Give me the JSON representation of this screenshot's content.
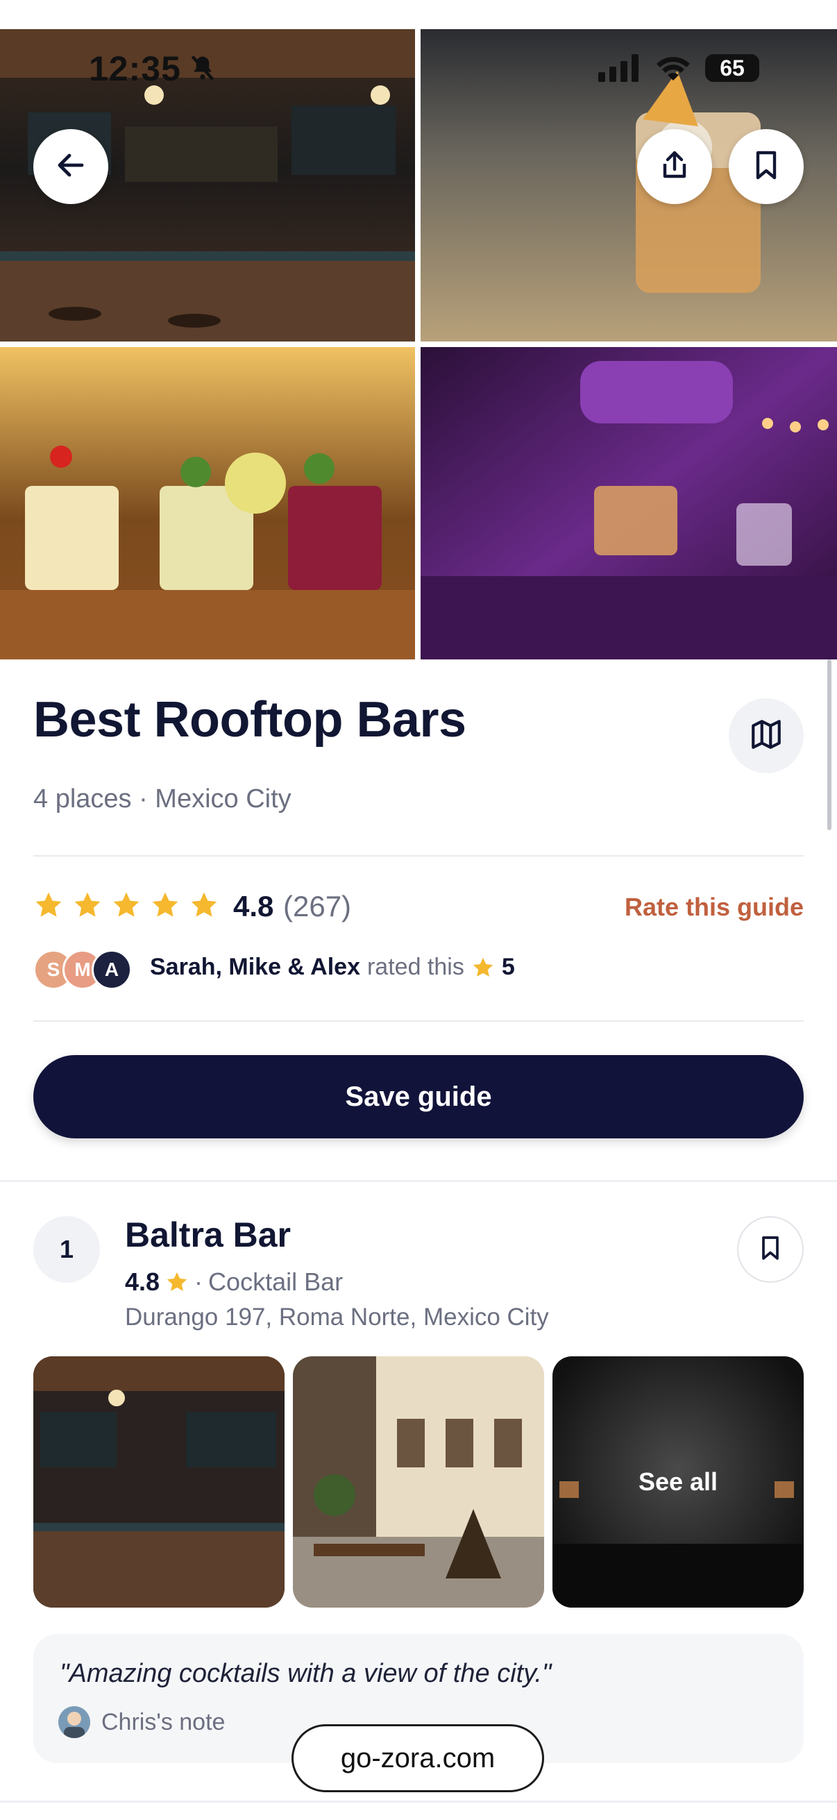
{
  "status_bar": {
    "time": "12:35",
    "battery": "65"
  },
  "guide": {
    "title": "Best Rooftop Bars",
    "subtitle": "4 places · Mexico City",
    "rating": "4.8",
    "rating_count": "(267)",
    "stars": 5,
    "rate_link": "Rate this guide",
    "rated_by": {
      "avatars": [
        "S",
        "M",
        "A"
      ],
      "names": "Sarah, Mike & Alex",
      "text": "rated this",
      "score": "5"
    },
    "save_button": "Save guide"
  },
  "places": [
    {
      "number": "1",
      "name": "Baltra Bar",
      "rating": "4.8",
      "separator": "·",
      "category": "Cocktail Bar",
      "address": "Durango 197, Roma Norte, Mexico City",
      "see_all_label": "See all",
      "note": {
        "quote": "\"Amazing cocktails with a view of the city.\"",
        "author": "Chris's note"
      }
    }
  ],
  "footer": {
    "domain": "go-zora.com"
  },
  "colors": {
    "primary_dark": "#12133a",
    "accent_link": "#c0603f",
    "star": "#f5b82e",
    "muted_text": "#6b6f80"
  },
  "icons": {
    "back": "arrow-left-icon",
    "share": "share-icon",
    "bookmark": "bookmark-icon",
    "map": "map-icon",
    "star": "star-icon"
  }
}
